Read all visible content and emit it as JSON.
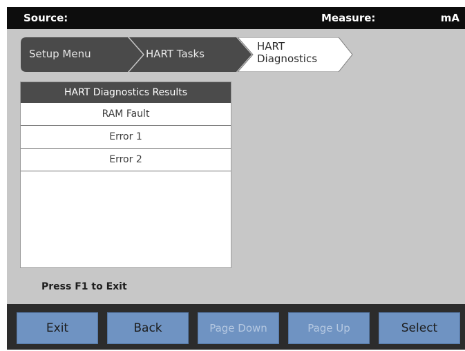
{
  "header": {
    "source_label": "Source:",
    "measure_label": "Measure:",
    "measure_unit": "mA"
  },
  "breadcrumb": {
    "items": [
      "Setup Menu",
      "HART Tasks",
      "HART Diagnostics"
    ]
  },
  "results": {
    "title": "HART Diagnostics Results",
    "rows": [
      "RAM Fault",
      "Error 1",
      "Error 2"
    ]
  },
  "hint": "Press F1 to Exit",
  "softkeys": [
    {
      "label": "Exit",
      "enabled": true
    },
    {
      "label": "Back",
      "enabled": true
    },
    {
      "label": "Page Down",
      "enabled": false
    },
    {
      "label": "Page Up",
      "enabled": false
    },
    {
      "label": "Select",
      "enabled": true
    }
  ],
  "colors": {
    "screen_bg": "#c7c7c7",
    "topbar_bg": "#0d0d0d",
    "softkey_bg": "#6f93c2",
    "crumb_dark": "#4a4a4a"
  }
}
